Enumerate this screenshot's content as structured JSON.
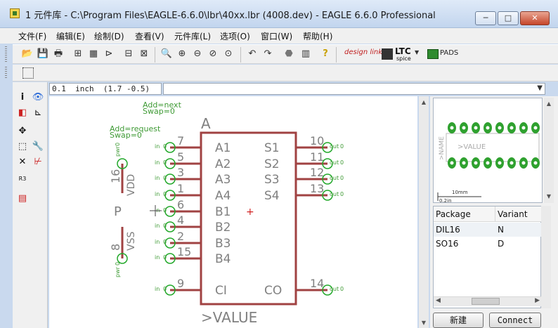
{
  "window": {
    "title": "1 元件库 - C:\\Program Files\\EAGLE-6.6.0\\lbr\\40xx.lbr (4008.dev) - EAGLE 6.6.0 Professional",
    "controls": {
      "minimize": "─",
      "maximize": "□",
      "close": "✕"
    }
  },
  "menu": [
    "文件(F)",
    "编辑(E)",
    "绘制(D)",
    "查看(V)",
    "元件库(L)",
    "选项(O)",
    "窗口(W)",
    "帮助(H)"
  ],
  "toolbar": {
    "design_link": "design link",
    "ltc": "LTC",
    "ltc_sub": "spice",
    "pads": "PADS"
  },
  "coord_bar": {
    "grid": "0.1",
    "unit": "inch",
    "position": "(1.7  -0.5)",
    "command_value": ""
  },
  "schematic": {
    "annotations": {
      "add_next": "Add=next",
      "swap_0": "Swap=0",
      "add_request": "Add=request",
      "swap_0b": "Swap=0"
    },
    "gate_name": "A",
    "value_label": ">VALUE",
    "left_pins": [
      {
        "num": "7",
        "name": "A1",
        "dir": "in",
        "pos": "0"
      },
      {
        "num": "5",
        "name": "A2",
        "dir": "in",
        "pos": "0"
      },
      {
        "num": "3",
        "name": "A3",
        "dir": "in",
        "pos": "0"
      },
      {
        "num": "1",
        "name": "A4",
        "dir": "in",
        "pos": "0"
      },
      {
        "num": "6",
        "name": "B1",
        "dir": "in",
        "pos": "0"
      },
      {
        "num": "4",
        "name": "B2",
        "dir": "in",
        "pos": "0"
      },
      {
        "num": "2",
        "name": "B3",
        "dir": "in",
        "pos": "0"
      },
      {
        "num": "15",
        "name": "B4",
        "dir": "in",
        "pos": "0"
      },
      {
        "num": "9",
        "name": "CI",
        "dir": "in",
        "pos": "0"
      }
    ],
    "right_pins": [
      {
        "num": "10",
        "name": "S1",
        "dir": "out",
        "pos": "0"
      },
      {
        "num": "11",
        "name": "S2",
        "dir": "out",
        "pos": "0"
      },
      {
        "num": "12",
        "name": "S3",
        "dir": "out",
        "pos": "0"
      },
      {
        "num": "13",
        "name": "S4",
        "dir": "out",
        "pos": "0"
      },
      {
        "num": "14",
        "name": "CO",
        "dir": "out",
        "pos": "0"
      }
    ],
    "power": {
      "p_label": "P",
      "vdd": {
        "num": "16",
        "name": "VDD",
        "dir": "pwr",
        "pos": "0"
      },
      "vss": {
        "num": "8",
        "name": "VSS",
        "dir": "pwr",
        "pos": "0"
      }
    }
  },
  "package_preview": {
    "name_label": ">NAME",
    "value_label": ">VALUE",
    "scale_mm": "10mm",
    "scale_in": "0.2in"
  },
  "variants": {
    "headers": [
      "Package",
      "Variant"
    ],
    "rows": [
      {
        "package": "DIL16",
        "variant": "N"
      },
      {
        "package": "SO16",
        "variant": "D"
      }
    ]
  },
  "buttons": {
    "new": "新建",
    "connect": "Connect"
  },
  "colors": {
    "symbol": "#a04242",
    "pin_text": "#808080",
    "power_text": "#3e9a34",
    "pin_endpoint": "#22a82a"
  }
}
